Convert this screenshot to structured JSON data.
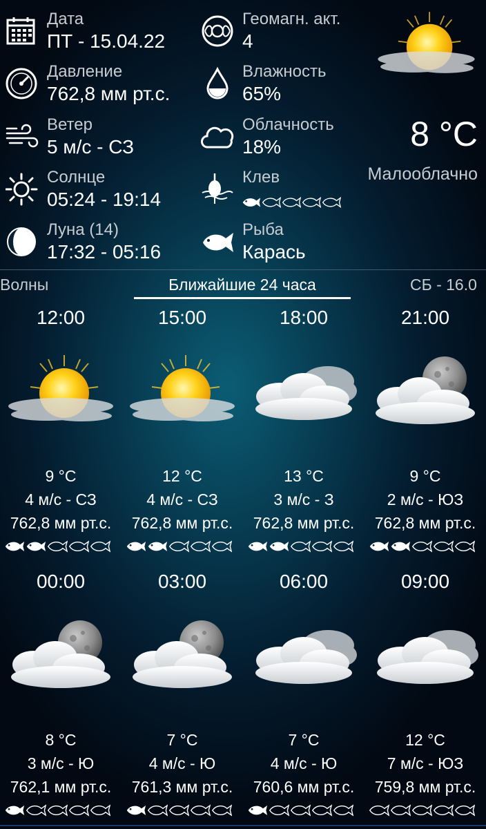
{
  "info": {
    "date": {
      "label": "Дата",
      "value": "ПТ - 15.04.22",
      "icon": "calendar-icon"
    },
    "pressure": {
      "label": "Давление",
      "value": "762,8 мм рт.с.",
      "icon": "barometer-icon"
    },
    "wind": {
      "label": "Ветер",
      "value": "5 м/с - СЗ",
      "icon": "wind-icon"
    },
    "sun": {
      "label": "Солнце",
      "value": "05:24 - 19:14",
      "icon": "sun-icon"
    },
    "moon": {
      "label": "Луна (14)",
      "value": "17:32 - 05:16",
      "icon": "moon-phase-icon"
    },
    "geomag": {
      "label": "Геомагн. акт.",
      "value": "4",
      "icon": "geomagnetic-icon"
    },
    "humidity": {
      "label": "Влажность",
      "value": "65%",
      "icon": "water-drop-icon"
    },
    "cloudiness": {
      "label": "Облачность",
      "value": "18%",
      "icon": "cloud-icon"
    },
    "bite": {
      "label": "Клев",
      "rating": 1,
      "max": 5,
      "icon": "fishing-float-icon"
    },
    "fish": {
      "label": "Рыба",
      "value": "Карась",
      "icon": "fish-icon"
    }
  },
  "current": {
    "temp": "8 °C",
    "description": "Малооблачно",
    "icon": "partly-cloudy-day"
  },
  "tabs": {
    "left": "Волны",
    "center": "Ближайшие 24 часа",
    "right": "СБ - 16.0"
  },
  "forecast": [
    {
      "time": "12:00",
      "temp": "9 °C",
      "wind": "4 м/с - СЗ",
      "pressure": "762,8 мм рт.с.",
      "bite": 2,
      "icon": "partly-cloudy-day"
    },
    {
      "time": "15:00",
      "temp": "12 °C",
      "wind": "4 м/с - СЗ",
      "pressure": "762,8 мм рт.с.",
      "bite": 2,
      "icon": "partly-cloudy-day"
    },
    {
      "time": "18:00",
      "temp": "13 °C",
      "wind": "3 м/с - З",
      "pressure": "762,8 мм рт.с.",
      "bite": 2,
      "icon": "cloudy"
    },
    {
      "time": "21:00",
      "temp": "9 °C",
      "wind": "2 м/с - ЮЗ",
      "pressure": "762,8 мм рт.с.",
      "bite": 2,
      "icon": "partly-cloudy-night"
    },
    {
      "time": "00:00",
      "temp": "8 °C",
      "wind": "3 м/с - Ю",
      "pressure": "762,1 мм рт.с.",
      "bite": 1,
      "icon": "partly-cloudy-night"
    },
    {
      "time": "03:00",
      "temp": "7 °C",
      "wind": "4 м/с - Ю",
      "pressure": "761,3 мм рт.с.",
      "bite": 1,
      "icon": "partly-cloudy-night"
    },
    {
      "time": "06:00",
      "temp": "7 °C",
      "wind": "4 м/с - Ю",
      "pressure": "760,6 мм рт.с.",
      "bite": 1,
      "icon": "cloudy"
    },
    {
      "time": "09:00",
      "temp": "12 °C",
      "wind": "7 м/с - ЮЗ",
      "pressure": "759,8 мм рт.с.",
      "bite": 0,
      "icon": "cloudy"
    }
  ]
}
